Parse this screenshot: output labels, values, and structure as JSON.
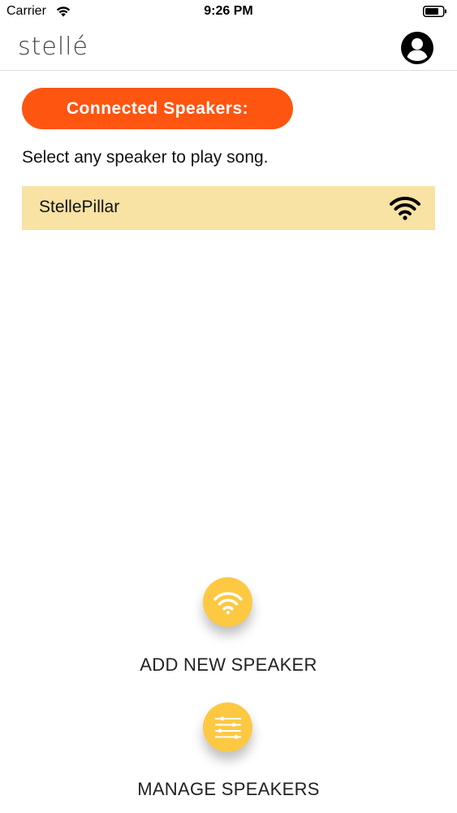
{
  "status_bar": {
    "carrier": "Carrier",
    "time": "9:26 PM",
    "wifi_icon": "wifi-icon",
    "battery_icon": "battery-icon"
  },
  "header": {
    "logo": "stellé",
    "profile_icon": "user-circle-icon"
  },
  "speakers_section": {
    "title": "Connected Speakers:",
    "instruction": "Select any speaker to play song.",
    "speakers": [
      {
        "name": "StellePillar",
        "icon": "wifi-icon"
      }
    ]
  },
  "actions": {
    "add_label": "ADD NEW SPEAKER",
    "add_icon": "wifi-icon",
    "manage_label": "MANAGE SPEAKERS",
    "manage_icon": "sliders-icon"
  },
  "colors": {
    "accent_orange": "#fe5511",
    "row_highlight": "#f8e2a4",
    "action_yellow": "#fdc943"
  }
}
